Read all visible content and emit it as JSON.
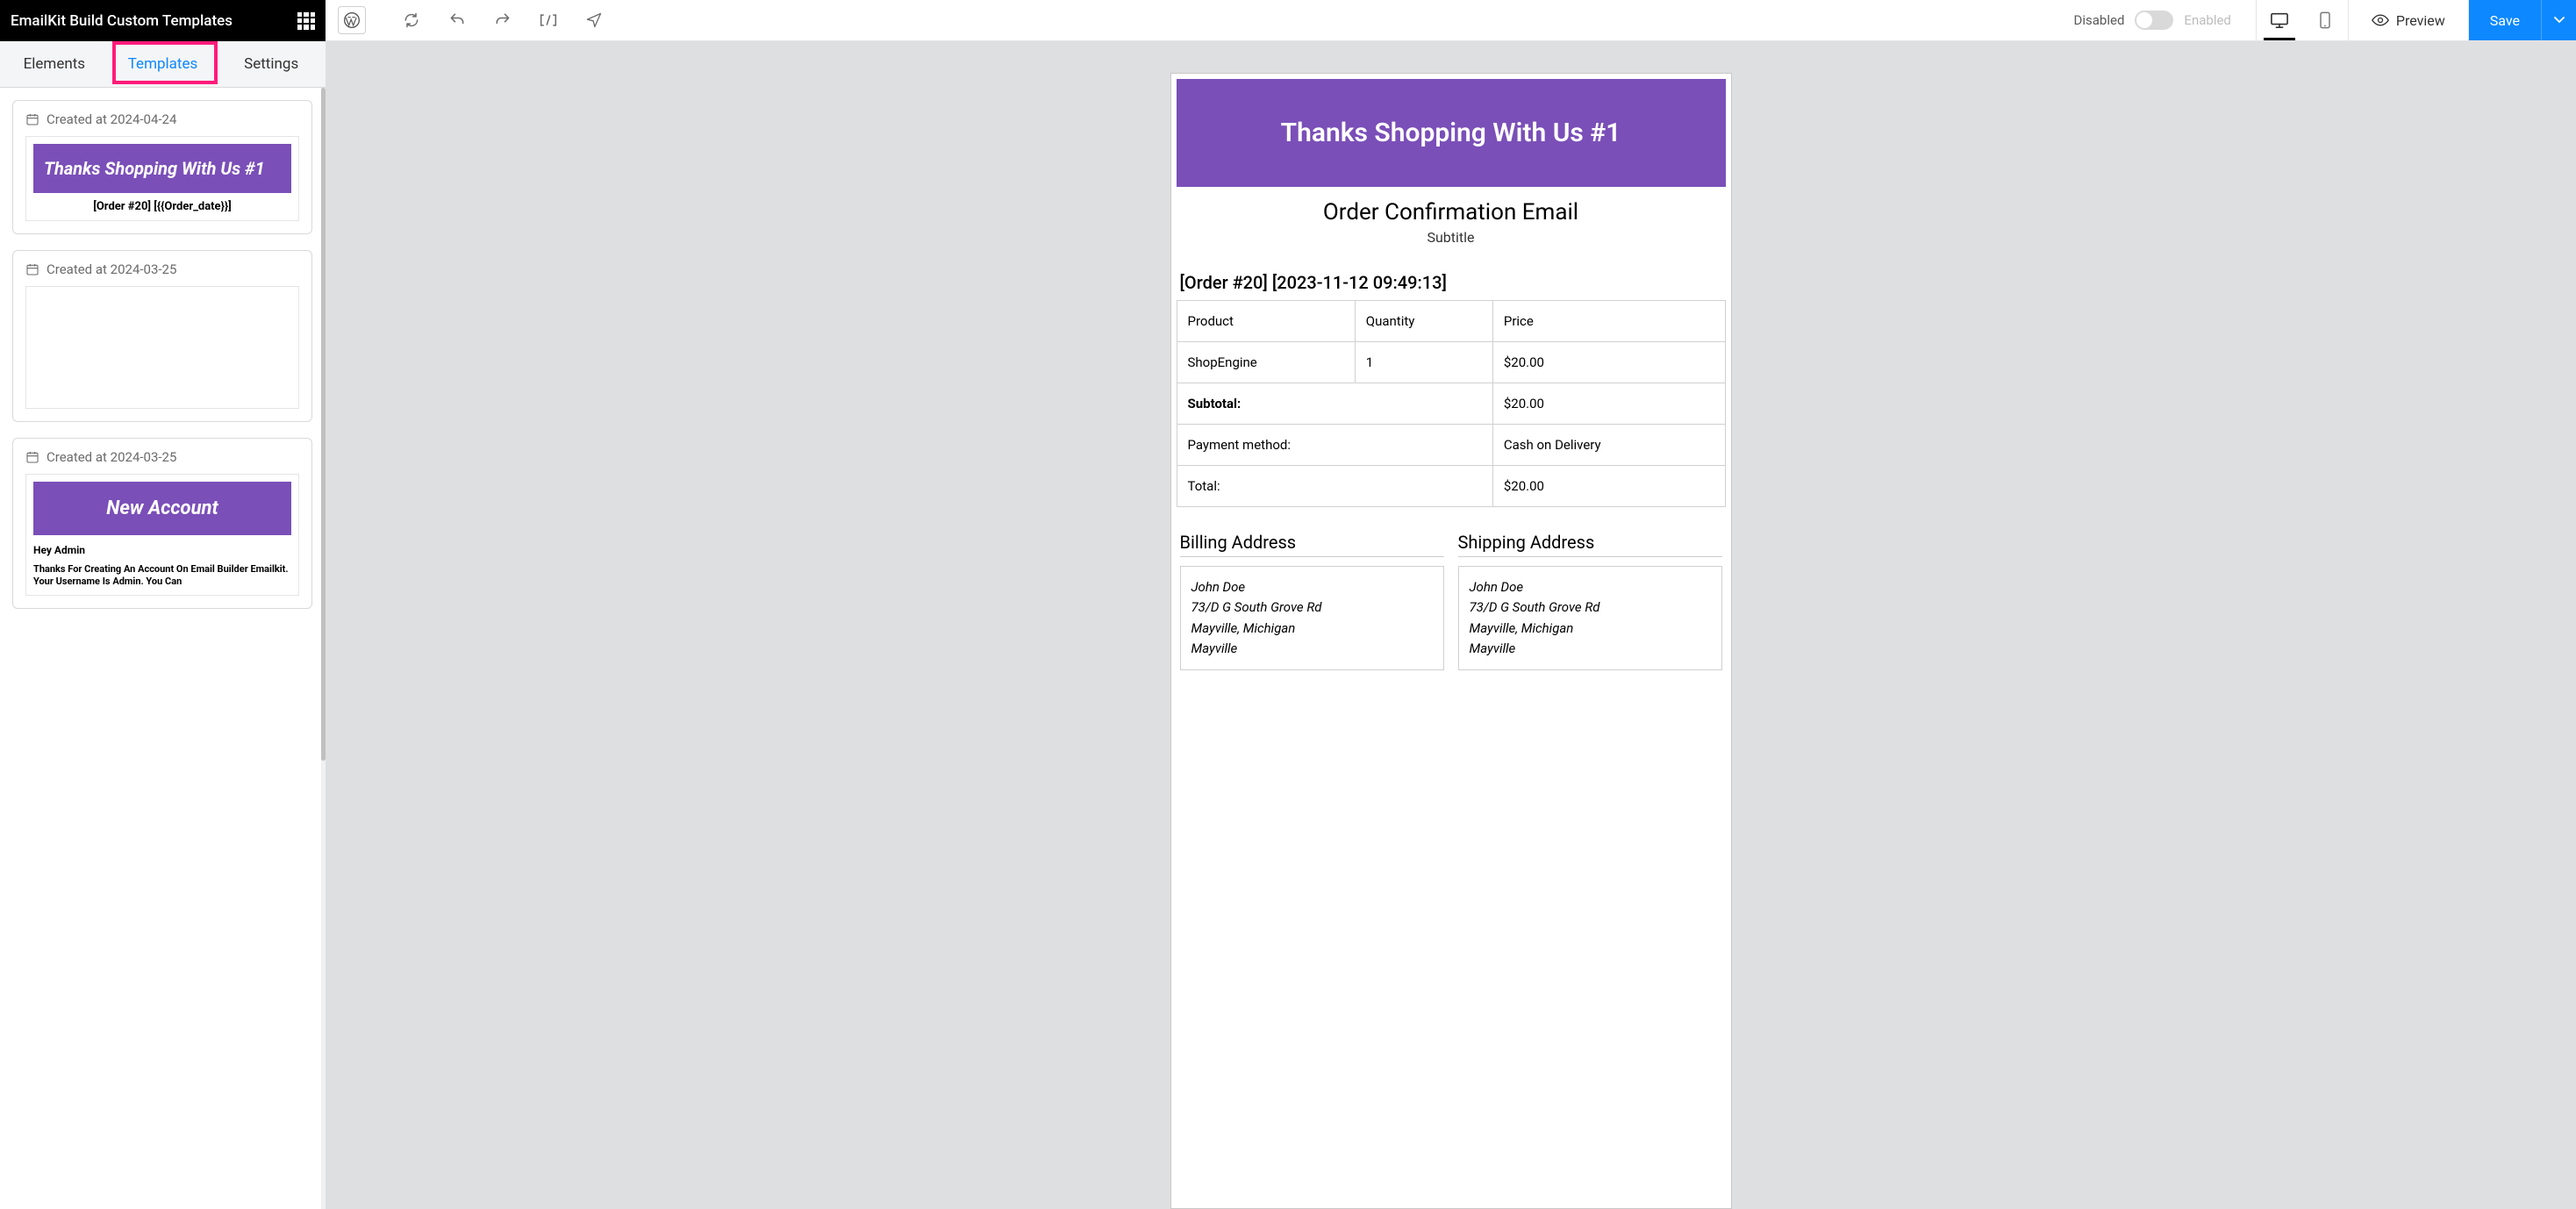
{
  "app": {
    "title": "EmailKit Build Custom Templates"
  },
  "sideTabs": {
    "elements": "Elements",
    "templates": "Templates",
    "settings": "Settings"
  },
  "templates": [
    {
      "meta": "Created at 2024-04-24",
      "heroLines": "Thanks Shopping With Us #1",
      "sub": "[Order #20] [{{Order_date}}]"
    },
    {
      "meta": "Created at 2024-03-25"
    },
    {
      "meta": "Created at 2024-03-25",
      "hero": "New Account",
      "greet": "Hey Admin",
      "body": "Thanks For Creating An Account On Email Builder Emailkit. Your Username Is Admin. You Can"
    }
  ],
  "topbar": {
    "disabled": "Disabled",
    "enabled": "Enabled",
    "preview": "Preview",
    "save": "Save"
  },
  "email": {
    "hero": "Thanks Shopping With Us #1",
    "h2": "Order Confirmation Email",
    "subtitle": "Subtitle",
    "orderLine": "[Order #20] [2023-11-12 09:49:13]",
    "headers": {
      "product": "Product",
      "qty": "Quantity",
      "price": "Price"
    },
    "item": {
      "name": "ShopEngine",
      "qty": "1",
      "price": "$20.00"
    },
    "rows": {
      "subtotalLabel": "Subtotal:",
      "subtotalVal": "$20.00",
      "paymentLabel": "Payment method:",
      "paymentVal": "Cash on Delivery",
      "totalLabel": "Total:",
      "totalVal": "$20.00"
    },
    "billingTitle": "Billing Address",
    "shippingTitle": "Shipping Address",
    "addr": {
      "name": "John Doe",
      "street": "73/D G South Grove Rd",
      "cityState": "Mayville, Michigan",
      "city": "Mayville"
    }
  }
}
